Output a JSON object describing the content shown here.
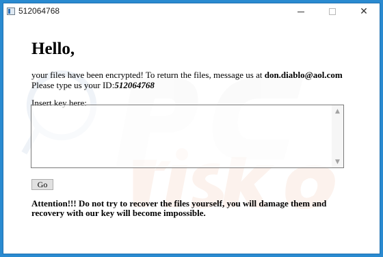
{
  "window": {
    "title": "512064768",
    "controls": {
      "minimize": "minimize-icon",
      "maximize": "maximize-icon",
      "close": "close-icon"
    }
  },
  "content": {
    "heading": "Hello,",
    "message_prefix": "your files have been encrypted! To return the files, message us at ",
    "email": "don.diablo@aol.com",
    "id_prefix": "Please type us your ID:",
    "id_value": "512064768",
    "key_label": "Insert key here:",
    "key_value": "",
    "go_label": "Go",
    "warning": "Attention!!! Do not try to recover the files yourself, you will damage them and recovery with our key will become impossible."
  },
  "watermark_text": "PC risk.com",
  "colors": {
    "desktop": "#2a8ad0",
    "window_border": "#1c6fb0"
  }
}
